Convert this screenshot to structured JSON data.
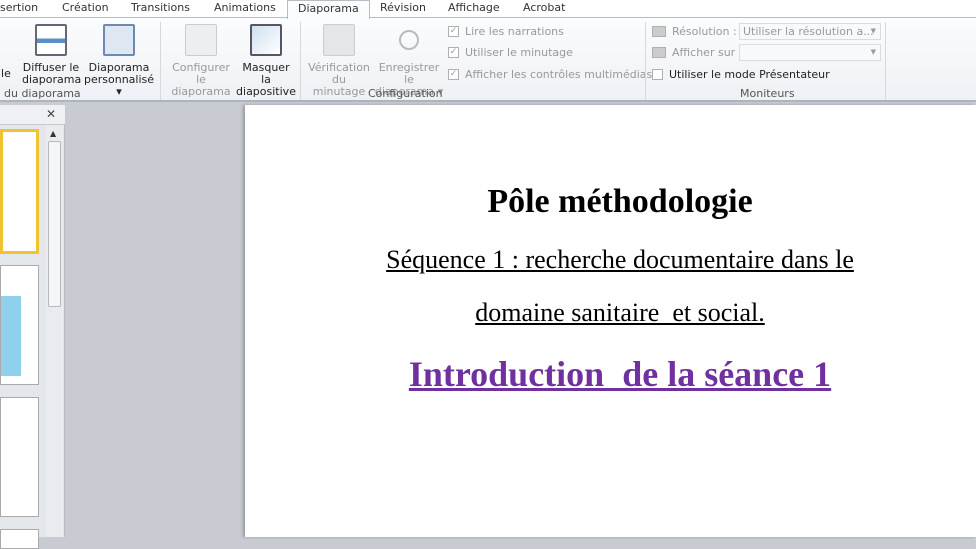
{
  "tabs": [
    "sertion",
    "Création",
    "Transitions",
    "Animations",
    "Diaporama",
    "Révision",
    "Affichage",
    "Acrobat"
  ],
  "active_tab": "Diaporama",
  "ribbon": {
    "group1": {
      "label": "du diaporama",
      "partial_button": "lle",
      "broadcast": [
        "Diffuser le",
        "diaporama"
      ],
      "custom": [
        "Diaporama",
        "personnalisé ▾"
      ]
    },
    "config": {
      "label": "Configuration",
      "setup": [
        "Configurer",
        "le diaporama"
      ],
      "hide": [
        "Masquer la",
        "diapositive"
      ],
      "rehearse": [
        "Vérification",
        "du minutage"
      ],
      "record": [
        "Enregistrer le",
        "diaporama ▾"
      ],
      "checks": [
        {
          "label": "Lire les narrations",
          "checked": true
        },
        {
          "label": "Utiliser le minutage",
          "checked": true
        },
        {
          "label": "Afficher les contrôles multimédias",
          "checked": true
        }
      ]
    },
    "monitors": {
      "label": "Moniteurs",
      "resolution_label": "Résolution :",
      "resolution_value": "Utiliser la résolution a...",
      "show_on_label": "Afficher sur :",
      "show_on_value": "",
      "presenter_label": "Utiliser le mode Présentateur",
      "presenter_checked": false
    }
  },
  "panel": {
    "close": "✕"
  },
  "slide": {
    "title": "Pôle méthodologie",
    "line1": "Séquence 1 : recherche documentaire dans le",
    "line2": "domaine sanitaire  et social.",
    "subtitle": "Introduction  de la séance 1",
    "subtitle_color": "#7030a0"
  }
}
